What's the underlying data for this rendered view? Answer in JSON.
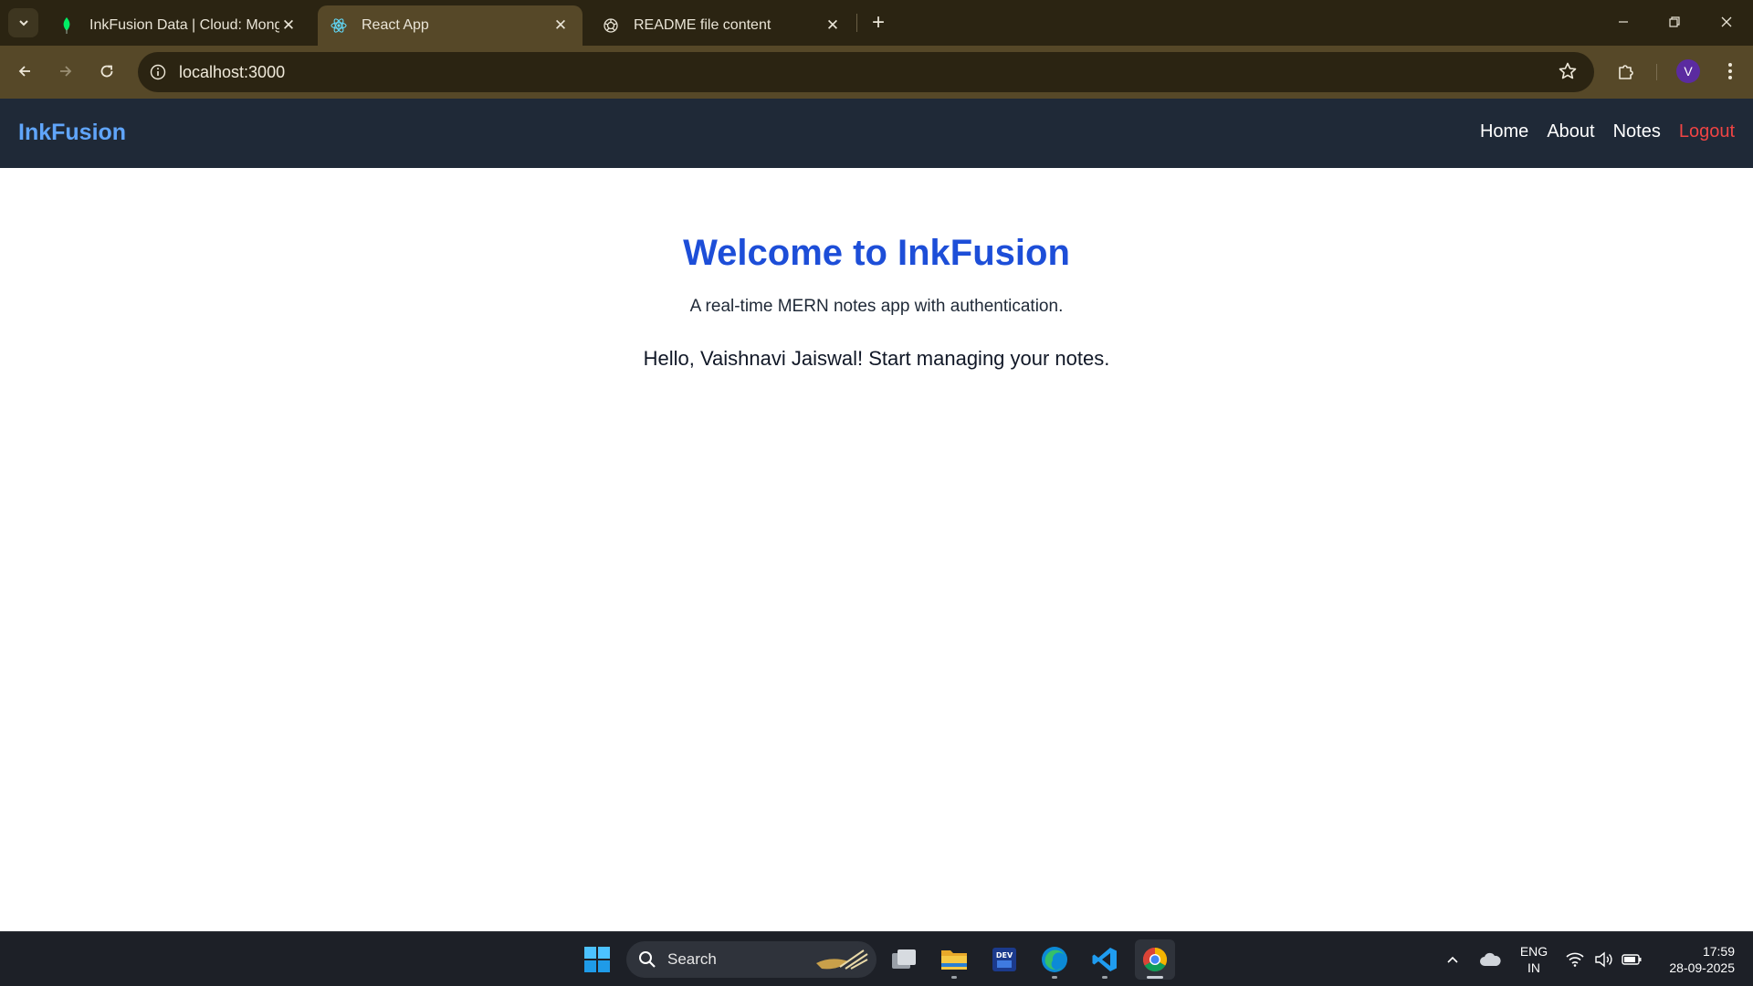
{
  "browser": {
    "tabs": [
      {
        "title": "InkFusion Data | Cloud: MongoDB",
        "icon": "mongodb-leaf-icon",
        "active": false
      },
      {
        "title": "React App",
        "icon": "react-icon",
        "active": true
      },
      {
        "title": "README file content",
        "icon": "chatgpt-icon",
        "active": false
      }
    ],
    "url": "localhost:3000",
    "profile_initial": "V",
    "colors": {
      "tabstrip": "#2b2412",
      "toolbar": "#564828",
      "profile": "#5b2ba0"
    }
  },
  "app": {
    "brand": "InkFusion",
    "nav": {
      "home": "Home",
      "about": "About",
      "notes": "Notes",
      "logout": "Logout"
    },
    "hero": {
      "title": "Welcome to InkFusion",
      "subtitle": "A real-time MERN notes app with authentication.",
      "greeting": "Hello, Vaishnavi Jaiswal! Start managing your notes."
    },
    "colors": {
      "nav_bg": "#1f2937",
      "brand": "#60a5fa",
      "title": "#1d4ed8",
      "logout": "#ef4444"
    }
  },
  "taskbar": {
    "search_label": "Search",
    "apps": [
      "windows-start-icon",
      "task-view-icon",
      "file-explorer-icon",
      "dev-home-icon",
      "edge-icon",
      "vscode-icon",
      "chrome-icon"
    ],
    "lang_line1": "ENG",
    "lang_line2": "IN",
    "time": "17:59",
    "date": "28-09-2025"
  }
}
